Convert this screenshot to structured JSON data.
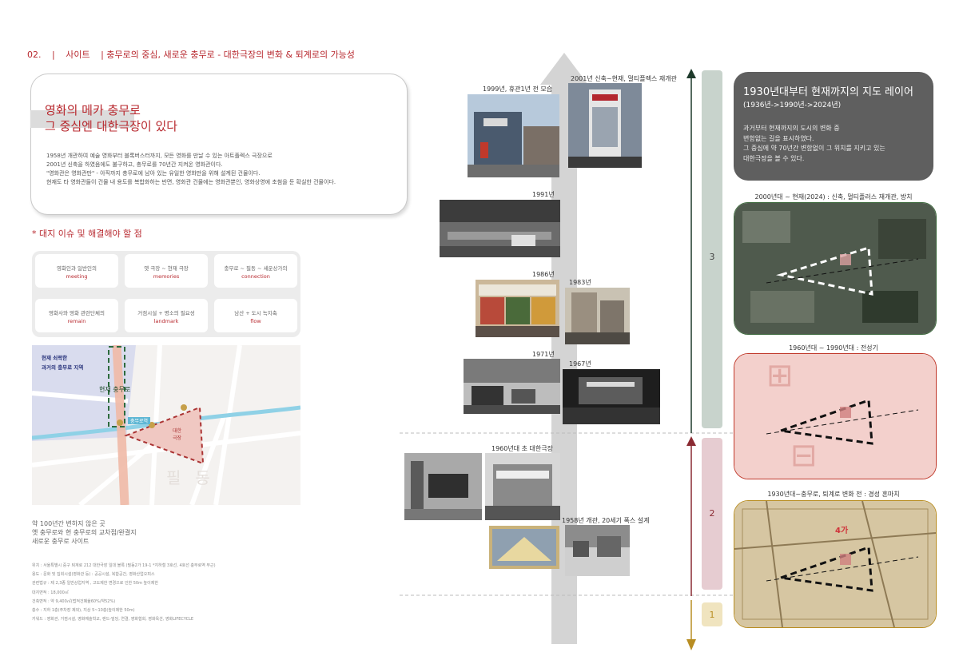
{
  "header": {
    "num": "02.",
    "sep": "|",
    "section": "사이트",
    "title": "| 충무로의 중심, 새로운 충무로 - 대한극장의 변화 & 퇴계로의 가능성"
  },
  "intro": {
    "title": "영화의 메카 충무로\n그 중심엔 대한극장이 있다",
    "lines": [
      "1958년 개관하여 예술 영화부터 블록버스터까지, 모든 영화를 만날 수 있는 아트플렉스 극장으로",
      "2001년 신축을 하였음에도 불구하고, 충무로를 70년간 지켜온 영화관이다.",
      "\"영화관은 영화관만\" - 아직까지 충무로에 남아 있는 유일한 영화만을 위해 설계된 건물이다.",
      "현재도 타 영화관들이 건물 내 용도를 복합화하는 반면, 영화관 건물에는 영화관뿐인, 영화상영에 초첨을 둔 확실한 건물이다."
    ]
  },
  "issues": {
    "heading": "* 대지 이슈 및 해결해야 할 점",
    "cells": [
      {
        "kr": "영화인과 일반인의",
        "en": "meeting"
      },
      {
        "kr": "옛 극장 ~ 현재 극장",
        "en": "memories"
      },
      {
        "kr": "충무로 ~ 필동 ~ 세운상가의",
        "en": "connection"
      },
      {
        "kr": "영화사와 영화 관련단체의",
        "en": "remain"
      },
      {
        "kr": "거점시설 + 명소의 필요성",
        "en": "landmark"
      },
      {
        "kr": "남산 + 도시 녹지축",
        "en": "flow"
      }
    ]
  },
  "map": {
    "caption_line1": "현재 쇠락한",
    "caption_line2": "과거의 충무로 지역",
    "street_label": "현재 충무로",
    "station_label": "충무로역",
    "site_label": "대한\n극장",
    "district_label": "필동"
  },
  "summary": {
    "lines": [
      "약 100년간 변하지 않은 곳",
      "옛 충무로와 현 충무로의 교차점/완결지",
      "새로운 충무로 사이트"
    ],
    "specs": [
      "위치 : 서울특별시 중구 퇴계로 212 대한극장 일대 블록 (필동2가 19-1 *지하철 3호선, 4호선 충무로역 부근)",
      "용도 : 문화 및 집회시설(영화관 등) : 공공시설, 복합공간, 영화산업오피스",
      "관련법규 : 제 2,3종 일반상업지역 , 고도제한 변경으로 인한 50m 높이제한",
      "대지면적 : 18,000㎡",
      "건축면적 : 약 9,400㎡(법적건폐율60%/약52%)",
      "층수 : 지하 1층(주차장 제외), 지상 5~10층(높이제한 50m)",
      "키워드 : 영화관, 거점시설, 영화예술학교, 랜드-빌딩, 연결, 영화협회, 영화옥션, 영화LIFECYCLE"
    ]
  },
  "timeline": {
    "labels": {
      "y1999": "1999년, 휴관1년 전 모습",
      "y2001": "2001년 신축~현재, 멀티플렉스 재개관",
      "y1991": "1991년",
      "y1986": "1986년",
      "y1983": "1983년",
      "y1971": "1971년",
      "y1967": "1967년",
      "y1960": "1960년대 초 대한극장",
      "y1958": "1958년 개관, 20세기 폭스 설계"
    },
    "phases": {
      "p3": "3",
      "p2": "2",
      "p1": "1"
    }
  },
  "layers": {
    "title": "1930년대부터 현재까지의 지도 레이어",
    "subtitle": "(1936년->1990년->2024년)",
    "body": [
      "과거부터 현재까지의 도시의 변화 중",
      "변함없는 길을 표시하였다.",
      "그 중심에 약 70년간 변함없이 그 위치를 지키고 있는",
      "대한극장을 볼 수 있다."
    ],
    "map1_label": "2000년대 ~ 현재(2024) : 신축, 멀티플러스 재개관, 방치",
    "map2_label": "1960년대 ~ 1990년대 : 전성기",
    "map3_label": "1930년대~충무로, 퇴계로 변화 전 : 경성 혼마치",
    "map3_mark": "4가"
  },
  "colors": {
    "accent": "#b8292f",
    "phase3": "#c8d3cc",
    "phase2": "#e6ccd1",
    "phase1": "#f0e4bf"
  }
}
